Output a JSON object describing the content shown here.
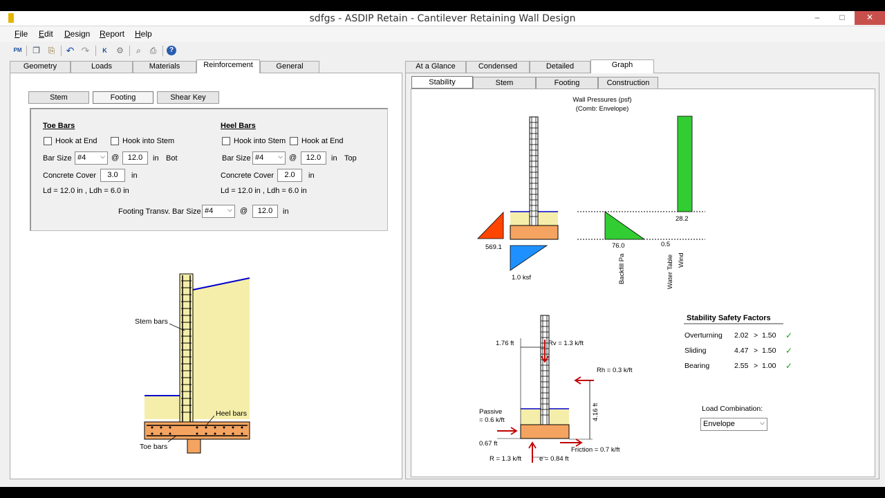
{
  "window": {
    "title": "sdfgs - ASDIP Retain - Cantilever Retaining Wall Design"
  },
  "menu": [
    "File",
    "Edit",
    "Design",
    "Report",
    "Help"
  ],
  "menu_underline": [
    "F",
    "E",
    "D",
    "R",
    "H"
  ],
  "menu_rest": [
    "ile",
    "dit",
    "esign",
    "eport",
    "elp"
  ],
  "toolbar_icons": [
    "pm-icon",
    "copy-icon",
    "paste-icon",
    "undo-icon",
    "redo-icon",
    "calculate-icon",
    "settings-icon",
    "preview-icon",
    "print-icon",
    "help-icon"
  ],
  "left_tabs": [
    "Geometry",
    "Loads",
    "Materials",
    "Reinforcement",
    "General"
  ],
  "left_sub_tabs": [
    "Stem",
    "Footing",
    "Shear Key"
  ],
  "toe": {
    "title": "Toe Bars",
    "hook_end": "Hook at End",
    "hook_stem": "Hook into Stem",
    "bar_size_label": "Bar Size",
    "bar_size": "#4",
    "at": "@",
    "spacing": "12.0",
    "unit": "in",
    "position": "Bot",
    "cover_label": "Concrete Cover",
    "cover": "3.0",
    "ld": "Ld = 12.0 in , Ldh = 6.0 in"
  },
  "heel": {
    "title": "Heel Bars",
    "hook_stem": "Hook into Stem",
    "hook_end": "Hook at End",
    "bar_size_label": "Bar Size",
    "bar_size": "#4",
    "at": "@",
    "spacing": "12.0",
    "unit": "in",
    "position": "Top",
    "cover_label": "Concrete Cover",
    "cover": "2.0",
    "ld": "Ld = 12.0 in , Ldh = 6.0 in"
  },
  "transv": {
    "label": "Footing Transv. Bar Size",
    "bar_size": "#4",
    "at": "@",
    "spacing": "12.0",
    "unit": "in"
  },
  "left_diagram": {
    "stem_bars": "Stem bars",
    "heel_bars": "Heel bars",
    "toe_bars": "Toe bars"
  },
  "right_tabs": [
    "At a Glance",
    "Condensed",
    "Detailed",
    "Graph"
  ],
  "right_sub_tabs": [
    "Stability",
    "Stem",
    "Footing",
    "Construction"
  ],
  "pressure_diagram": {
    "title": "Wall Pressures (psf)",
    "subtitle": "(Comb: Envelope)",
    "passive": "569.1",
    "bearing": "1.0 ksf",
    "backfill": "76.0",
    "water": "0.5",
    "wind": "28.2",
    "backfill_label": "Backfill Pa",
    "water_label": "Water Table",
    "wind_label": "Wind"
  },
  "force_diagram": {
    "rv_arm": "1.76 ft",
    "rv": "Rv = 1.3 k/ft",
    "rh": "Rh = 0.3 k/ft",
    "height": "4.16 ft",
    "passive_label": "Passive",
    "passive": "= 0.6 k/ft",
    "passive_arm": "0.67 ft",
    "friction": "Friction = 0.7 k/ft",
    "r": "R = 1.3 k/ft",
    "e": "e = 0.84 ft"
  },
  "safety": {
    "title": "Stability Safety Factors",
    "rows": [
      {
        "name": "Overturning",
        "value": "2.02",
        "op": ">",
        "limit": "1.50"
      },
      {
        "name": "Sliding",
        "value": "4.47",
        "op": ">",
        "limit": "1.50"
      },
      {
        "name": "Bearing",
        "value": "2.55",
        "op": ">",
        "limit": "1.00"
      }
    ],
    "check_color": "#1a9a1a"
  },
  "load_combination": {
    "label": "Load Combination:",
    "value": "Envelope"
  },
  "colors": {
    "soil": "#f5eeaa",
    "concrete": "#f4a460",
    "passive": "#ff4500",
    "bearing": "#1e90ff",
    "backfill": "#32cd32",
    "water_line": "#0000cd"
  }
}
